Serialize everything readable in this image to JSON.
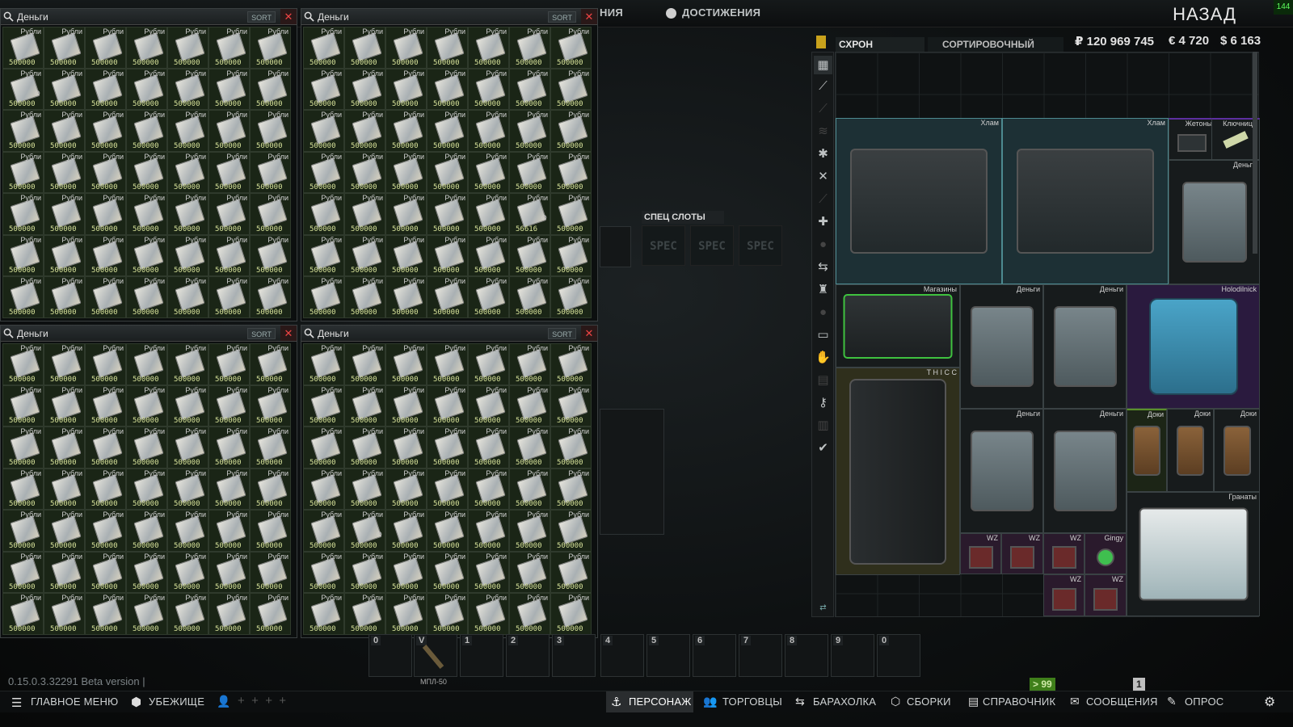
{
  "top_tabs": [
    "НИЯ",
    "ДОСТИЖЕНИЯ"
  ],
  "back_label": "НАЗАД",
  "fps": "144",
  "money_windows": [
    {
      "title": "Деньги",
      "sort": "SORT",
      "close": "✕",
      "rows": 7,
      "cols": 7,
      "item_label": "Рубли",
      "item_value": "500000",
      "special": {
        "row": 1,
        "col": 0,
        "check": "⊘"
      }
    },
    {
      "title": "Деньги",
      "sort": "SORT",
      "close": "✕",
      "rows": 7,
      "cols": 7,
      "item_label": "Рубли",
      "item_value": "500000",
      "special": {
        "row": 4,
        "col": 5,
        "value": "56616",
        "check": "⊘"
      }
    },
    {
      "title": "Деньги",
      "sort": "SORT",
      "close": "✕",
      "rows": 7,
      "cols": 7,
      "item_label": "Рубли",
      "item_value": "500000"
    },
    {
      "title": "Деньги",
      "sort": "SORT",
      "close": "✕",
      "rows": 7,
      "cols": 7,
      "item_label": "Рубли",
      "item_value": "500000",
      "special": {
        "row": 4,
        "col": 1,
        "check": "⊘"
      }
    }
  ],
  "spec": {
    "title": "СПЕЦ СЛОТЫ",
    "slot_label": "SPEC"
  },
  "quickbar": {
    "slots": [
      "4",
      "5",
      "6",
      "7",
      "8",
      "9",
      "0"
    ],
    "item_label": "МПЛ-50",
    "first_slots": [
      "0",
      "V",
      "1",
      "2",
      "3"
    ]
  },
  "version": "0.15.0.3.32291 Beta version |",
  "stash": {
    "tab_stash": "СХРОН",
    "tab_sort": "СОРТИРОВОЧНЫЙ СТОЛ",
    "money_rub": "₽ 120 969 745",
    "money_eur": "€ 4 720",
    "money_usd": "$ 6 163",
    "labels": {
      "junk1": "Хлам",
      "junk2": "Хлам",
      "tokens": "Жетоны",
      "keys": "Ключница",
      "money_case": "Деньги",
      "mags": "Магазины",
      "thicc": "T H I C C",
      "m1": "Деньги",
      "m2": "Деньги",
      "holo": "Holodilnick",
      "m3": "Деньги",
      "m4": "Деньги",
      "doc1": "Доки",
      "doc2": "Доки",
      "doc3": "Доки",
      "grenades": "Гранаты",
      "wz1": "WZ",
      "wz2": "WZ",
      "wz3": "WZ",
      "gingy": "Gingy",
      "wz4": "WZ",
      "wz5": "WZ"
    }
  },
  "bottom": {
    "main_menu": "ГЛАВНОЕ МЕНЮ",
    "hideout": "УБЕЖИЩЕ",
    "character": "ПЕРСОНАЖ",
    "traders": "ТОРГОВЦЫ",
    "flea": "БАРАХОЛКА",
    "builds": "СБОРКИ",
    "handbook": "СПРАВОЧНИК",
    "messages": "СООБЩЕНИЯ",
    "survey": "ОПРОС",
    "badge_green": "> 99",
    "badge_gray": "1"
  },
  "colors": {
    "accent_green": "#6fbf2a",
    "case_teal": "#2f4a52"
  }
}
